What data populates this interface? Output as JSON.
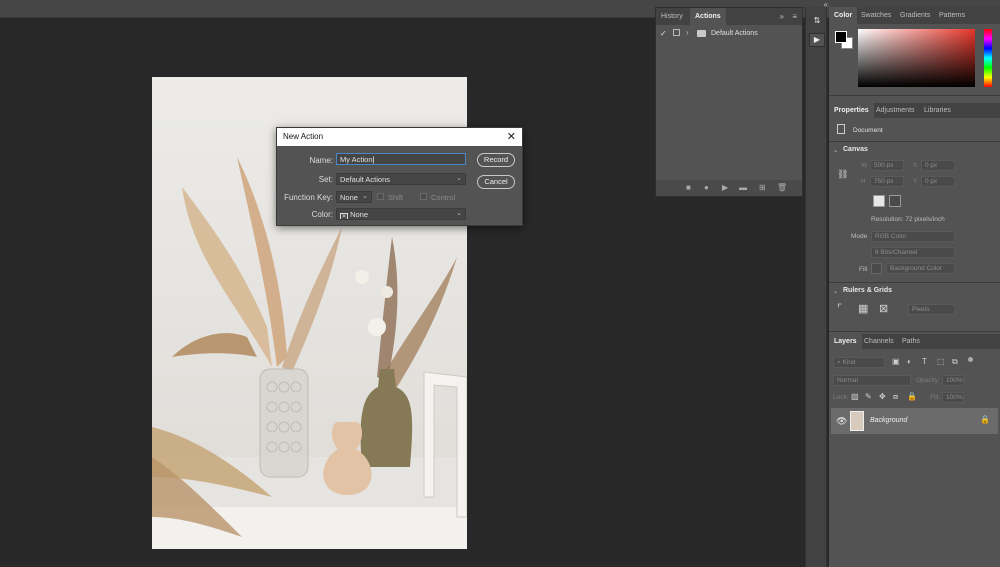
{
  "dialog": {
    "title": "New Action",
    "name_label": "Name:",
    "name_value": "My Action",
    "set_label": "Set:",
    "set_value": "Default Actions",
    "function_key_label": "Function Key:",
    "function_key_value": "None",
    "shift_label": "Shift",
    "control_label": "Control",
    "color_label": "Color:",
    "color_value": "None",
    "record_label": "Record",
    "cancel_label": "Cancel"
  },
  "actions_panel": {
    "tabs": [
      "History",
      "Actions"
    ],
    "set_name": "Default Actions"
  },
  "color_panel": {
    "tabs": [
      "Color",
      "Swatches",
      "Gradients",
      "Patterns"
    ]
  },
  "properties_panel": {
    "tabs": [
      "Properties",
      "Adjustments",
      "Libraries"
    ],
    "document_label": "Document",
    "canvas_heading": "Canvas",
    "w_label": "W",
    "w_value": "500 px",
    "h_label": "H",
    "h_value": "750 px",
    "x_label": "X",
    "x_value": "0 px",
    "y_label": "Y",
    "y_value": "0 px",
    "resolution": "Resolution: 72 pixels/inch",
    "mode_label": "Mode",
    "mode_value": "RGB Color",
    "bits_value": "8 Bits/Channel",
    "fill_label": "Fill",
    "fill_value": "Background Color",
    "rulers_heading": "Rulers & Grids",
    "units_value": "Pixels"
  },
  "layers_panel": {
    "tabs": [
      "Layers",
      "Channels",
      "Paths"
    ],
    "kind_label": "Kind",
    "blend_mode": "Normal",
    "opacity_label": "Opacity:",
    "opacity_value": "100%",
    "lock_label": "Lock:",
    "fill_label": "Fill:",
    "fill_value": "100%",
    "layer_name": "Background"
  },
  "colors": {
    "accent": "#e8362a",
    "workspace": "#282828",
    "panel": "#535353"
  }
}
